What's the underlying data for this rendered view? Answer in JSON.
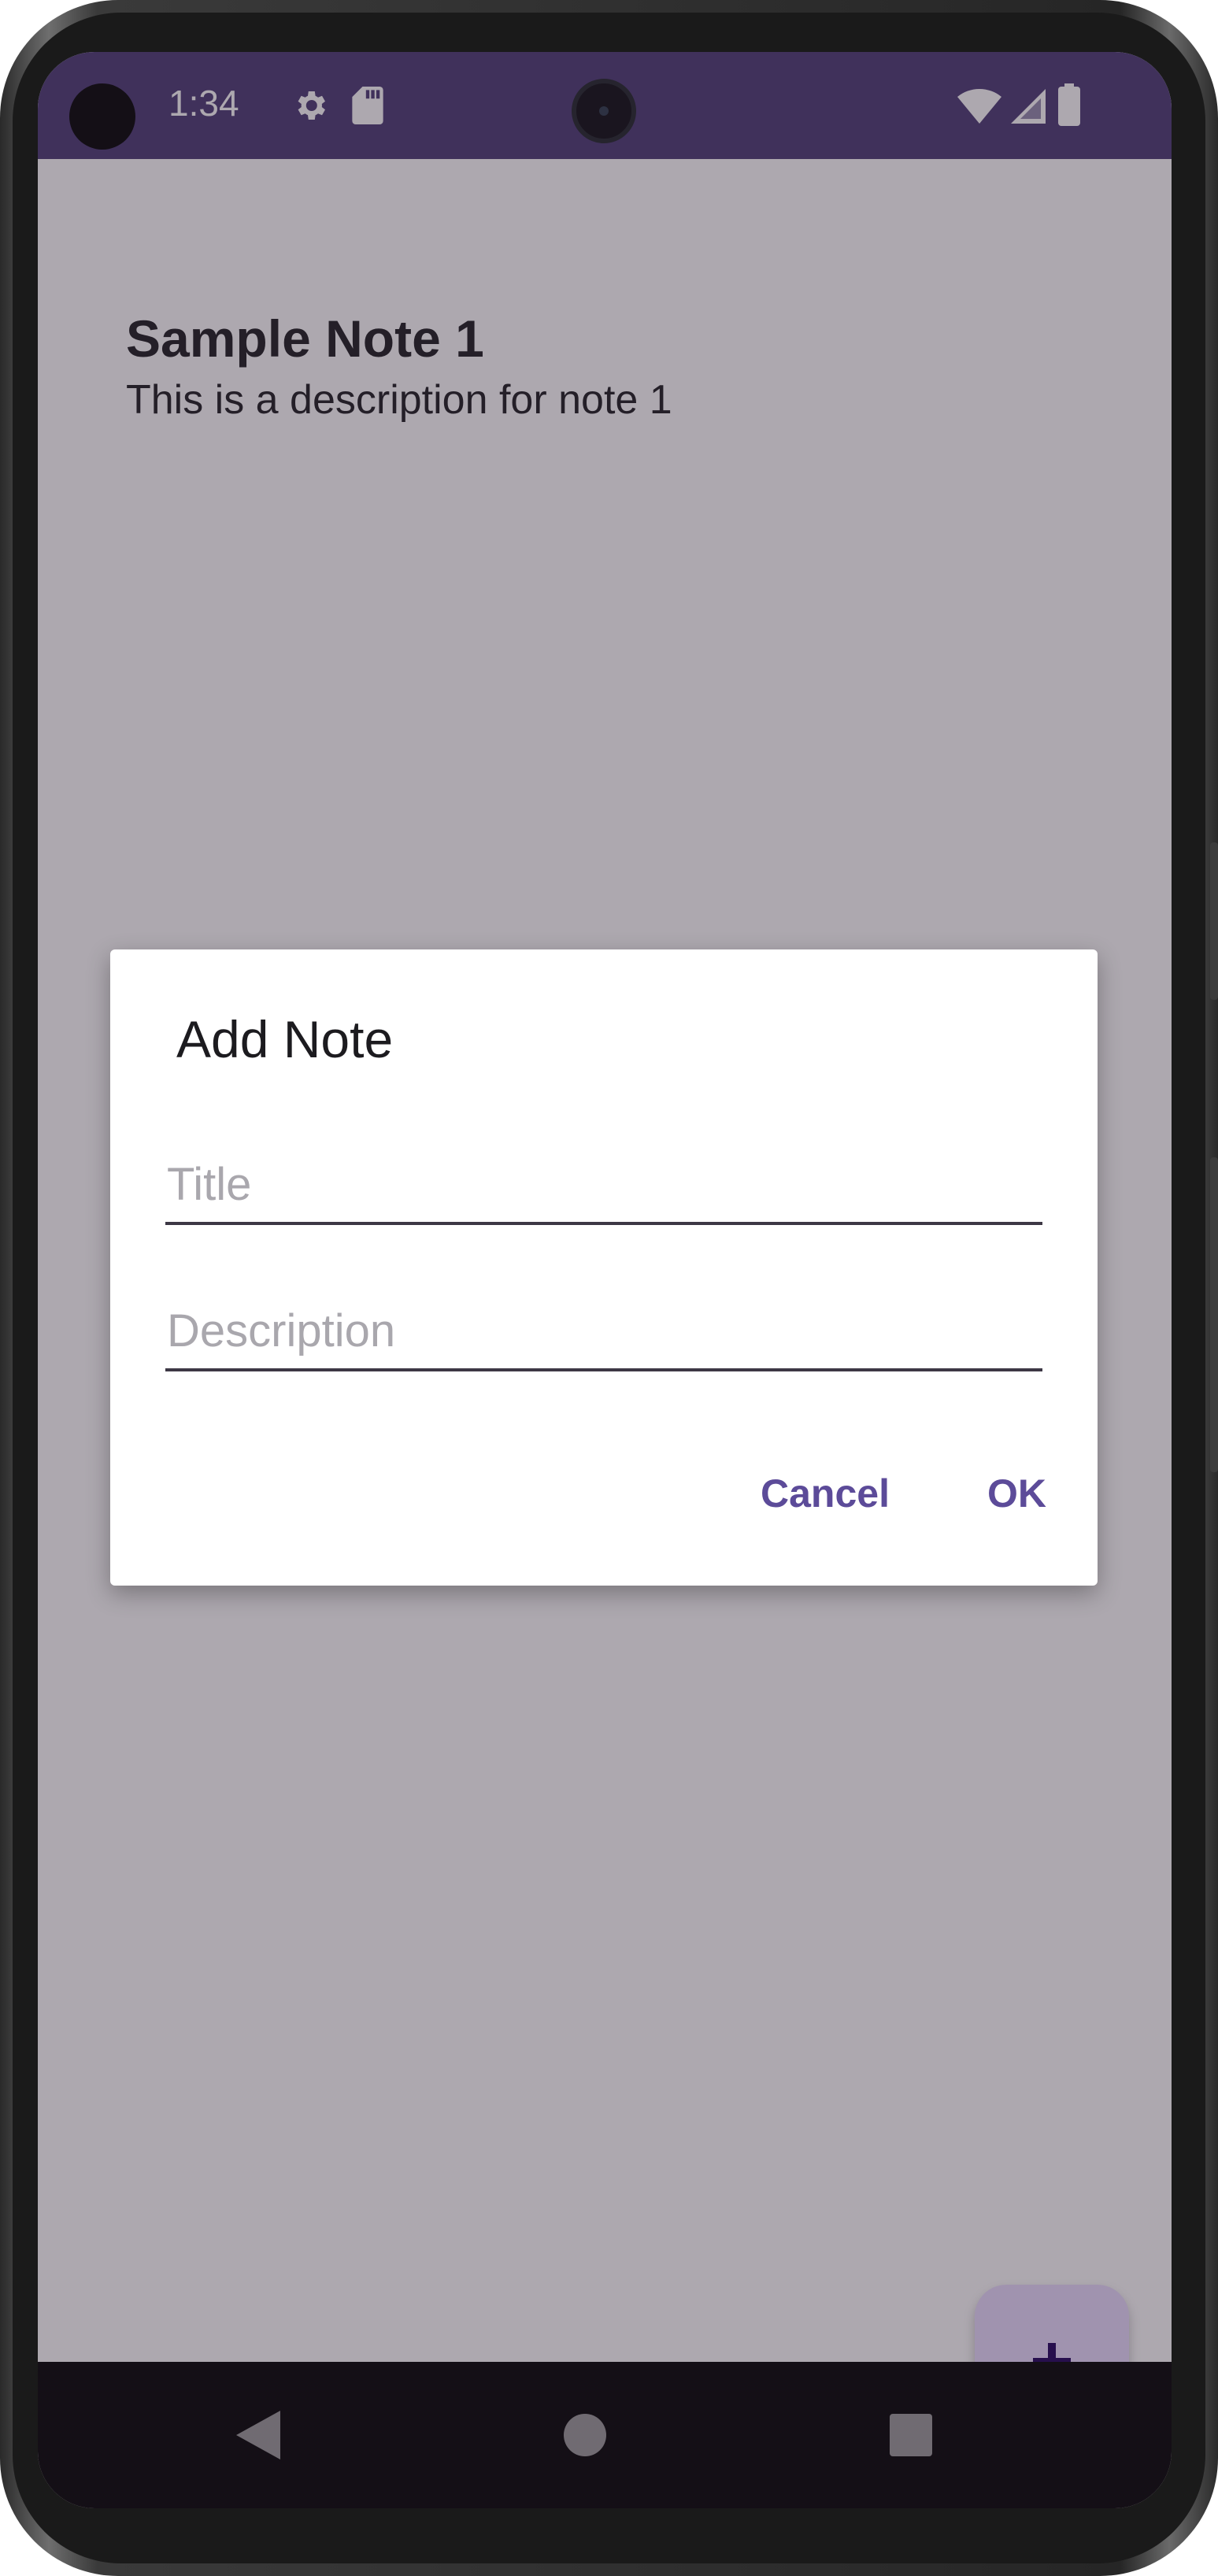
{
  "status_bar": {
    "time": "1:34",
    "icons": [
      "settings-gear-icon",
      "sd-card-icon",
      "wifi-icon",
      "cellular-signal-icon",
      "battery-icon"
    ],
    "background_color": "#4a3a74"
  },
  "notes": [
    {
      "title": "Sample Note 1",
      "description": "This is a description for note 1"
    }
  ],
  "fab": {
    "icon": "plus-icon",
    "color": "#eaddff"
  },
  "dialog": {
    "title": "Add Note",
    "title_field": {
      "placeholder": "Title",
      "value": ""
    },
    "description_field": {
      "placeholder": "Description",
      "value": ""
    },
    "cancel_label": "Cancel",
    "ok_label": "OK",
    "accent_color": "#5c4b99"
  },
  "nav_bar": {
    "icons": [
      "back-icon",
      "home-icon",
      "recents-icon"
    ]
  }
}
